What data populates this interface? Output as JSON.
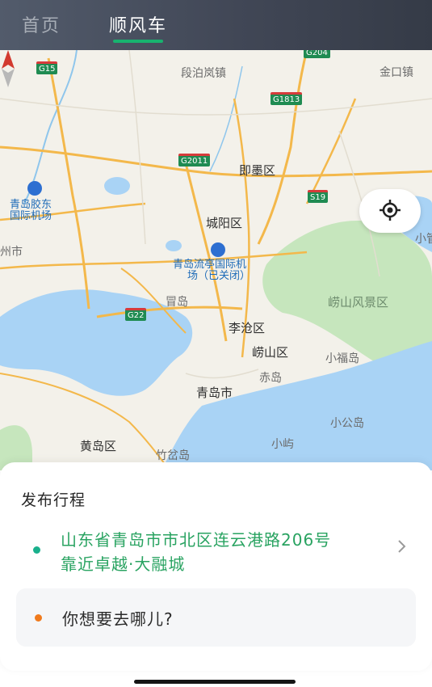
{
  "tabs": [
    {
      "label": "首页",
      "active": false
    },
    {
      "label": "顺风车",
      "active": true
    }
  ],
  "colors": {
    "accent_green": "#18b36f",
    "origin_text_green": "#29a361",
    "origin_dot": "#19b08c",
    "destination_dot": "#f07a1c",
    "water": "#a9d3f5",
    "park": "#bfe3b7"
  },
  "map": {
    "labels": {
      "duanbo": "段泊岚镇",
      "jinkou": "金口镇",
      "jimo": "即墨区",
      "airport_jiaodong_line1": "青岛胶东",
      "airport_jiaodong_line2": "国际机场",
      "chengyang": "城阳区",
      "airport_liuting_line1": "青岛流亭国际机",
      "airport_liuting_line2": "场（已关闭）",
      "laoshan_scenic": "崂山风景区",
      "maodao": "冒岛",
      "licang": "李沧区",
      "laoshan": "崂山区",
      "xiaofudao": "小福岛",
      "chidao": "赤岛",
      "qingdao": "青岛市",
      "xiaogongdao": "小公岛",
      "xiaoyu": "小屿",
      "huangdao": "黄岛区",
      "zhuchadao": "竹岔岛",
      "left_city": "州市",
      "right_xiao": "小管"
    },
    "highways": [
      "G15",
      "G204",
      "G1813",
      "G2011",
      "S19",
      "G22"
    ],
    "icons": [
      "compass-icon",
      "locate-icon",
      "airport-icon"
    ]
  },
  "trip": {
    "title": "发布行程",
    "origin_line1": "山东省青岛市市北区连云港路206号",
    "origin_line2": "靠近卓越·大融城",
    "destination_placeholder": "你想要去哪儿?"
  }
}
